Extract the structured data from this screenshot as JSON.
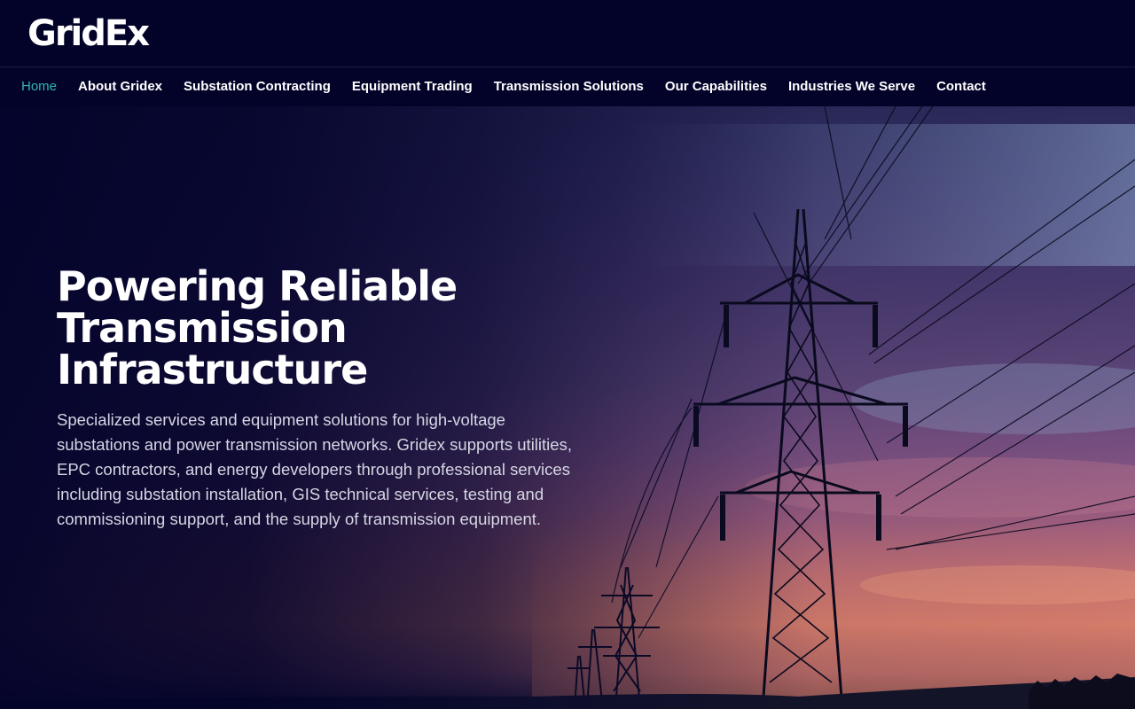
{
  "brand": {
    "logo_text": "GridEx"
  },
  "nav": {
    "items": [
      {
        "label": "Home",
        "active": true
      },
      {
        "label": "About Gridex"
      },
      {
        "label": "Substation Contracting"
      },
      {
        "label": "Equipment Trading"
      },
      {
        "label": "Transmission Solutions"
      },
      {
        "label": "Our Capabilities"
      },
      {
        "label": "Industries We Serve"
      },
      {
        "label": "Contact"
      }
    ]
  },
  "hero": {
    "title": "Powering Reliable Transmission Infrastructure",
    "description": "Specialized services and equipment solutions for high-voltage substations and power transmission networks. Gridex supports utilities, EPC contractors, and energy developers through professional services including substation installation, GIS technical services, testing and commissioning support, and the supply of transmission equipment.",
    "image": "sunset-transmission-towers-photo"
  },
  "colors": {
    "background": "#03032a",
    "nav_active": "#2fb6b0",
    "text": "#ffffff",
    "body_text": "#d6d6e4"
  }
}
